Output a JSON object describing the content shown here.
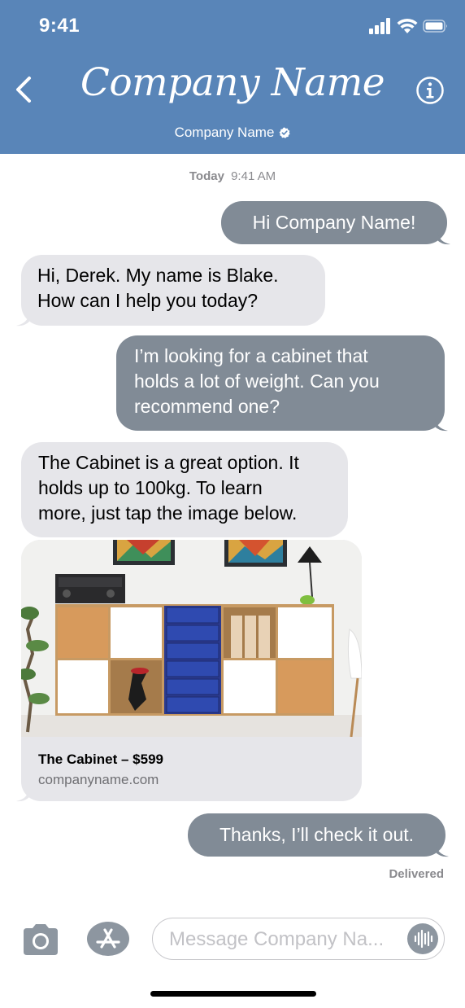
{
  "status_bar": {
    "time": "9:41"
  },
  "header": {
    "logo_text": "Company Name",
    "contact_name": "Company Name"
  },
  "conversation": {
    "timestamp_day": "Today",
    "timestamp_time": "9:41 AM",
    "messages": [
      {
        "direction": "outgoing",
        "text": "Hi Company Name!"
      },
      {
        "direction": "incoming",
        "text": "Hi, Derek. My name is Blake.\nHow can I help you today?"
      },
      {
        "direction": "outgoing",
        "text": "I’m looking for a cabinet that\nholds a lot of weight. Can you\nrecommend one?"
      },
      {
        "direction": "incoming",
        "text": "The Cabinet is a great option. It\nholds up to 100kg. To learn\nmore, just tap the image below."
      },
      {
        "direction": "incoming",
        "type": "link_preview",
        "title": "The Cabinet – $599",
        "domain": "companyname.com"
      },
      {
        "direction": "outgoing",
        "text": "Thanks, I’ll check it out."
      }
    ],
    "delivery_status": "Delivered"
  },
  "input_bar": {
    "placeholder": "Message Company Na..."
  },
  "icons": [
    "back-chevron-icon",
    "info-icon",
    "verified-badge-icon",
    "camera-icon",
    "app-store-icon",
    "audio-waveform-icon",
    "cellular-signal-icon",
    "wifi-icon",
    "battery-icon"
  ],
  "colors": {
    "header": "#5985b8",
    "outgoing_bubble": "#818b96",
    "incoming_bubble": "#e6e6ea",
    "icon_gray": "#8d96a0"
  }
}
